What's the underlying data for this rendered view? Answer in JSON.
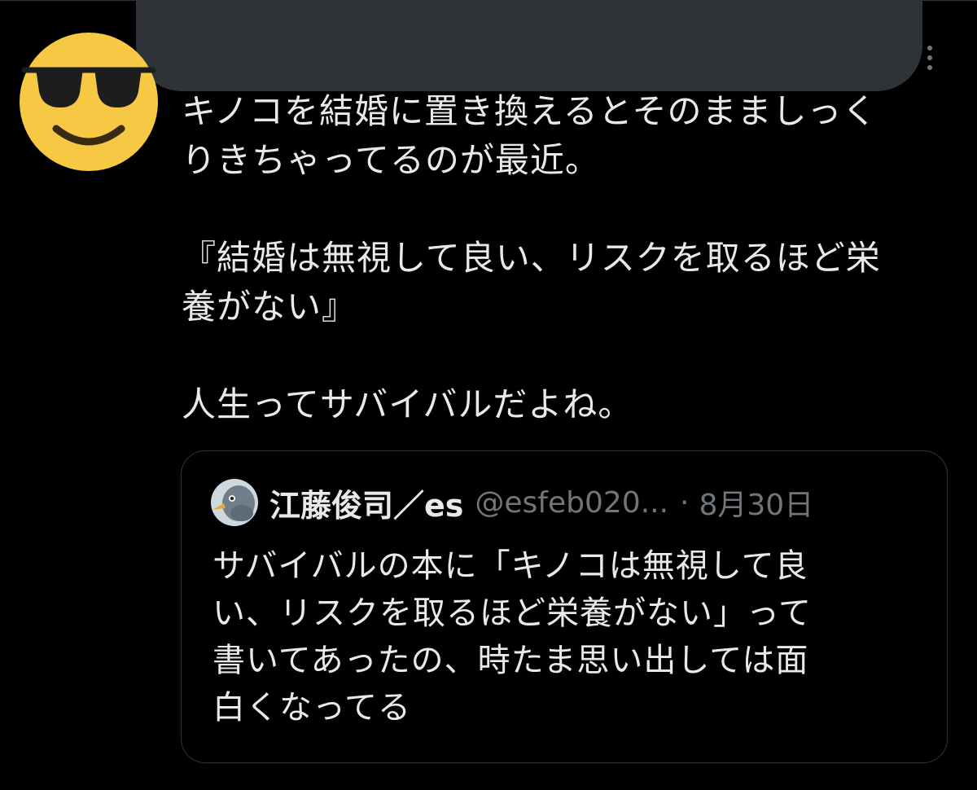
{
  "tweet": {
    "paragraphs": [
      "キノコを結婚に置き換えるとそのまましっく\nりきちゃってるのが最近。",
      "『結婚は無視して良い、リスクを取るほど栄\n養がない』",
      "人生ってサバイバルだよね。"
    ],
    "avatar_icon": "sunglasses-emoji-icon",
    "more_icon": "more-options-icon"
  },
  "quoted": {
    "name": "江藤俊司／es",
    "handle": "@esfeb020...",
    "separator": "·",
    "date": "8月30日",
    "text": "サバイバルの本に「キノコは無視して良\nい、リスクを取るほど栄養がない」って\n書いてあったの、時たま思い出しては面\n白くなってる",
    "avatar_icon": "pigeon-avatar-icon"
  },
  "colors": {
    "background": "#000000",
    "text": "#e7e9ea",
    "secondary_text": "#71767b",
    "border": "#2f3336",
    "redaction": "#2f3338",
    "emoji_face": "#f7c844"
  }
}
